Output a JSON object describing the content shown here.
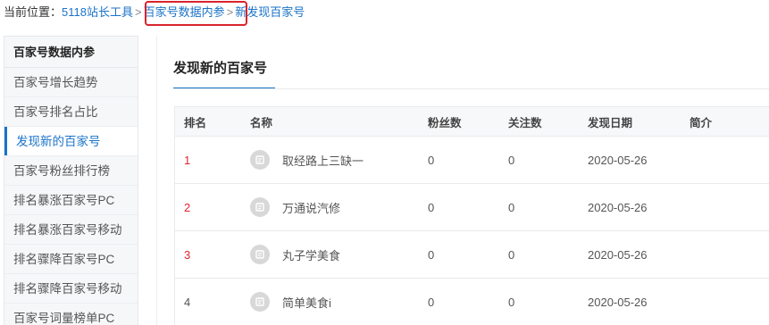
{
  "breadcrumb": {
    "prefix": "当前位置：",
    "items": [
      "5118站长工具",
      "百家号数据内参",
      "新发现百家号"
    ],
    "separator": ">"
  },
  "sidebar": {
    "header": "百家号数据内参",
    "items": [
      {
        "label": "百家号增长趋势",
        "active": false
      },
      {
        "label": "百家号排名占比",
        "active": false
      },
      {
        "label": "发现新的百家号",
        "active": true
      },
      {
        "label": "百家号粉丝排行榜",
        "active": false
      },
      {
        "label": "排名暴涨百家号PC",
        "active": false
      },
      {
        "label": "排名暴涨百家号移动",
        "active": false
      },
      {
        "label": "排名骤降百家号PC",
        "active": false
      },
      {
        "label": "排名骤降百家号移动",
        "active": false
      },
      {
        "label": "百家号词量榜单PC",
        "active": false
      }
    ]
  },
  "main": {
    "title": "发现新的百家号",
    "table": {
      "columns": [
        "排名",
        "名称",
        "粉丝数",
        "关注数",
        "发现日期",
        "简介"
      ],
      "rows": [
        {
          "rank": "1",
          "name": "取经路上三缺一",
          "fans": "0",
          "follows": "0",
          "date": "2020-05-26",
          "intro": ""
        },
        {
          "rank": "2",
          "name": "万通说汽修",
          "fans": "0",
          "follows": "0",
          "date": "2020-05-26",
          "intro": ""
        },
        {
          "rank": "3",
          "name": "丸子学美食",
          "fans": "0",
          "follows": "0",
          "date": "2020-05-26",
          "intro": ""
        },
        {
          "rank": "4",
          "name": "简单美食i",
          "fans": "0",
          "follows": "0",
          "date": "2020-05-26",
          "intro": ""
        }
      ]
    }
  },
  "colors": {
    "accent": "#1a73c8",
    "rank_highlight": "#e0262f",
    "annotation_box": "#d9232d"
  },
  "icons": {
    "avatar": "baijiahao-avatar-icon"
  }
}
